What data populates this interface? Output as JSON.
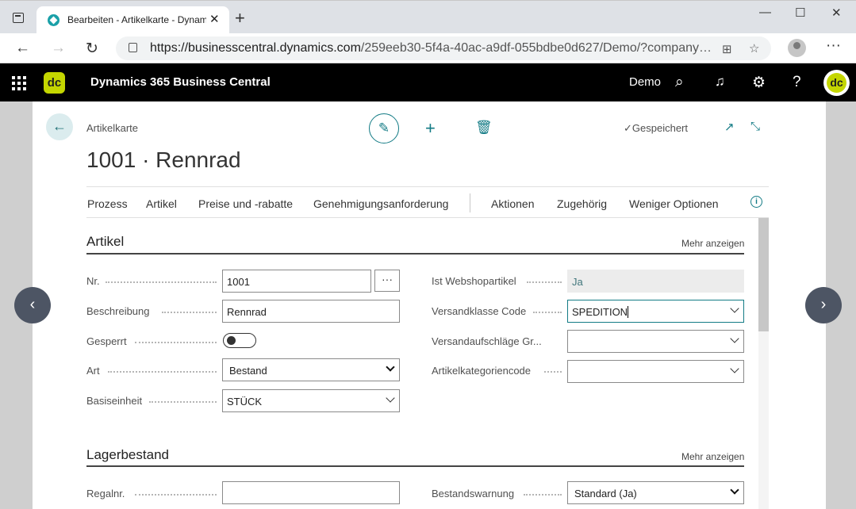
{
  "browser": {
    "tab_title": "Bearbeiten - Artikelkarte - Dynam",
    "tab_close": "✕",
    "new_tab": "+",
    "url_host": "https://businesscentral.dynamics.com",
    "url_path": "/259eeb30-5f4a-40ac-a9df-055bdbe0d627/Demo/?company…",
    "window_controls": {
      "minimize": "—",
      "maximize": "☐",
      "close": "✕"
    }
  },
  "appbar": {
    "logo": "dc",
    "title": "Dynamics 365 Business Central",
    "company": "Demo",
    "avatar": "dc"
  },
  "page": {
    "breadcrumb": "Artikelkarte",
    "title": "1001 · Rennrad",
    "status": "Gespeichert"
  },
  "actions": [
    "Prozess",
    "Artikel",
    "Preise und -rabatte",
    "Genehmigungsanforderung",
    "Aktionen",
    "Zugehörig",
    "Weniger Optionen"
  ],
  "section_artikel": {
    "title": "Artikel",
    "more": "Mehr anzeigen",
    "nr_label": "Nr.",
    "nr_value": "1001",
    "ellipsis": "···",
    "beschreibung_label": "Beschreibung",
    "beschreibung_value": "Rennrad",
    "gesperrt_label": "Gesperrt",
    "gesperrt_value": false,
    "art_label": "Art",
    "art_value": "Bestand",
    "basiseinheit_label": "Basiseinheit",
    "basiseinheit_value": "STÜCK",
    "webshop_label": "Ist Webshopartikel",
    "webshop_value": "Ja",
    "versandklasse_label": "Versandklasse Code",
    "versandklasse_value": "SPEDITION",
    "versandaufschlaege_label": "Versandaufschläge Gr...",
    "versandaufschlaege_value": "",
    "kategorie_label": "Artikelkategoriencode",
    "kategorie_value": ""
  },
  "section_lager": {
    "title": "Lagerbestand",
    "more": "Mehr anzeigen",
    "regalnr_label": "Regalnr.",
    "regalnr_value": "",
    "bestandswarnung_label": "Bestandswarnung",
    "bestandswarnung_value": "Standard (Ja)"
  },
  "colors": {
    "accent": "#137b85",
    "appbar": "#000000",
    "brand_logo": "#c4d600"
  }
}
